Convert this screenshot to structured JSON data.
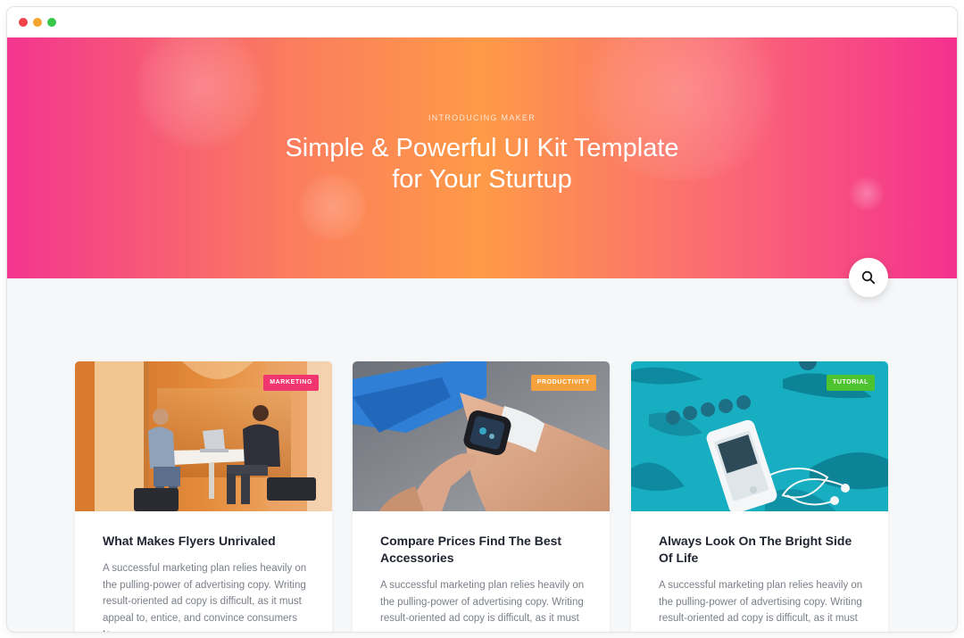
{
  "window": {
    "controls": [
      {
        "name": "close",
        "color": "#f0444a"
      },
      {
        "name": "minimize",
        "color": "#f5a632"
      },
      {
        "name": "maximize",
        "color": "#37c84a"
      }
    ]
  },
  "hero": {
    "eyebrow": "INTRODUCING MAKER",
    "title_line1": "Simple & Powerful UI Kit Template",
    "title_line2": "for Your Sturtup",
    "gradient": [
      "#f3358f",
      "#fb7d5e",
      "#fe9a47",
      "#fb6a74",
      "#f4308f"
    ]
  },
  "search": {
    "icon": "search-icon"
  },
  "cards": [
    {
      "badge": "MARKETING",
      "badge_color": "#f1356e",
      "title": "What Makes Flyers Unrivaled",
      "excerpt": "A successful marketing plan relies heavily on the pulling-power of advertising copy. Writing result-oriented ad copy is difficult, as it must appeal to, entice, and convince consumers to",
      "image": "two men working at laptops in an orange office booth"
    },
    {
      "badge": "PRODUCTIVITY",
      "badge_color": "#f6a13b",
      "title": "Compare Prices Find The Best Accessories",
      "excerpt": "A successful marketing plan relies heavily on the pulling-power of advertising copy. Writing result-oriented ad copy is difficult, as it must",
      "image": "hand tapping a smartwatch on a wrist"
    },
    {
      "badge": "TUTORIAL",
      "badge_color": "#4dc42f",
      "title": "Always Look On The Bright Side Of Life",
      "excerpt": "A successful marketing plan relies heavily on the pulling-power of advertising copy. Writing result-oriented ad copy is difficult, as it must",
      "image": "smartphone with earphones and blue feathers on turquoise background"
    }
  ]
}
